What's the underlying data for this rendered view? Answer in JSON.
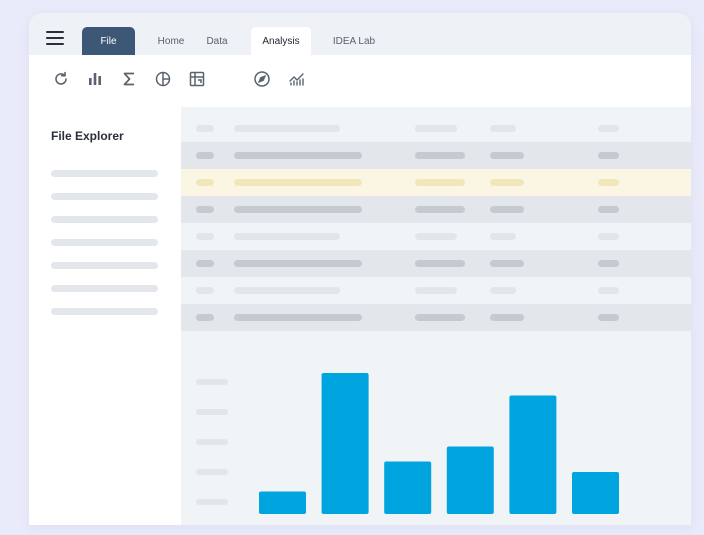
{
  "tabs": {
    "file": "File",
    "home": "Home",
    "data": "Data",
    "analysis": "Analysis",
    "idea": "IDEA Lab"
  },
  "toolbar": {
    "icons": [
      "refresh-icon",
      "bar-chart-icon",
      "sigma-icon",
      "pie-chart-icon",
      "pivot-table-icon",
      "compass-icon",
      "trend-chart-icon"
    ]
  },
  "sidebar": {
    "title": "File Explorer"
  },
  "colors": {
    "accent": "#3d5777",
    "bar": "#00a5df",
    "highlight_row": "#fbf6e4"
  },
  "table": {
    "rows": [
      "plain",
      "grey",
      "highlight",
      "grey",
      "plain",
      "grey",
      "plain",
      "grey"
    ]
  },
  "chart_data": {
    "type": "bar",
    "values": [
      1.5,
      9.4,
      3.5,
      4.5,
      7.9,
      2.8
    ],
    "ylim": [
      0,
      10
    ]
  }
}
